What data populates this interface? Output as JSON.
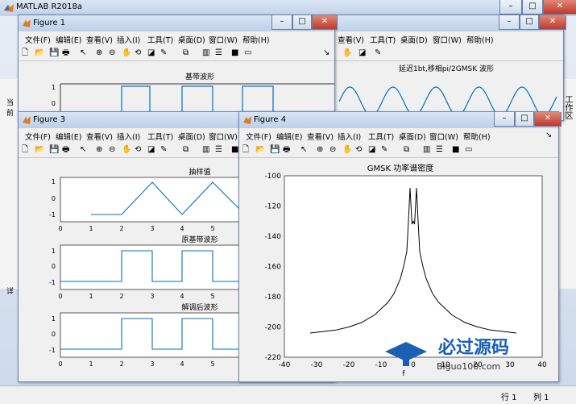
{
  "app": {
    "title": "MATLAB R2018a",
    "side_label_1": "当前",
    "side_label_2": "详",
    "right_label": "工作区",
    "status_row": "行 1",
    "status_col": "列 1"
  },
  "menu_labels": [
    "文件(F)",
    "编辑(E)",
    "查看(V)",
    "插入(I)",
    "工具(T)",
    "桌面(D)",
    "窗口(W)",
    "帮助(H)"
  ],
  "fig1": {
    "title": "Figure 1",
    "plot_title": "基带波形",
    "y_ticks": [
      "1",
      "0"
    ]
  },
  "fig2": {
    "plot_title": "延迟1bt,移相pi/2GMSK 波形"
  },
  "fig3": {
    "title": "Figure 3",
    "plot1_title": "抽样值",
    "plot2_title": "原基带波形",
    "plot3_title": "解调后波形",
    "y_ticks": [
      "1",
      "0",
      "-1"
    ],
    "x_ticks": [
      "0",
      "1",
      "2",
      "3",
      "4",
      "5"
    ]
  },
  "fig4": {
    "title": "Figure 4"
  },
  "chart_data": {
    "type": "line",
    "title": "GMSK 功率谱密度",
    "xlabel": "f",
    "ylabel": "",
    "xlim": [
      -40,
      40
    ],
    "ylim": [
      -220,
      -100
    ],
    "x_ticks": [
      "-40",
      "-30",
      "-20",
      "-10",
      "0",
      "10",
      "20",
      "30",
      "40"
    ],
    "y_ticks": [
      "-100",
      "-120",
      "-140",
      "-160",
      "-180",
      "-200",
      "-220"
    ],
    "series": [
      {
        "x": [
          -32,
          -28,
          -24,
          -20,
          -16,
          -12,
          -8,
          -6,
          -4,
          -3,
          -2,
          -1.5,
          -1,
          -0.7,
          -0.4,
          0,
          0.4,
          0.7,
          1,
          1.5,
          2,
          3,
          4,
          6,
          8,
          12,
          16,
          20,
          24,
          28,
          32
        ],
        "y": [
          -204,
          -203,
          -202,
          -200,
          -197,
          -192,
          -184,
          -178,
          -168,
          -160,
          -150,
          -130,
          -108,
          -120,
          -132,
          -130,
          -132,
          -120,
          -108,
          -130,
          -150,
          -160,
          -168,
          -178,
          -184,
          -192,
          -197,
          -200,
          -202,
          -203,
          -204
        ]
      }
    ]
  },
  "watermark": {
    "line1": "必过源码",
    "line2": "Biguo100.com"
  }
}
